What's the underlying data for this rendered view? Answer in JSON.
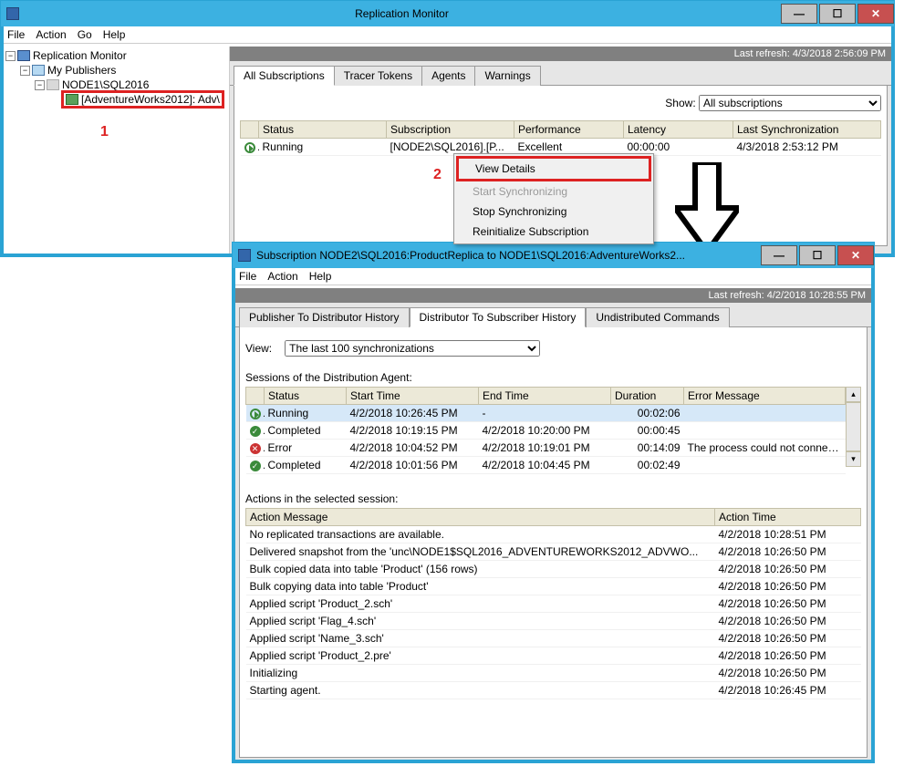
{
  "win1": {
    "title": "Replication Monitor",
    "menu": [
      "File",
      "Action",
      "Go",
      "Help"
    ],
    "refresh": "Last refresh: 4/3/2018 2:56:09 PM",
    "tree": {
      "root": "Replication Monitor",
      "pubs": "My Publishers",
      "node": "NODE1\\SQL2016",
      "db": "[AdventureWorks2012]: Adv\\"
    },
    "tabs": [
      "All Subscriptions",
      "Tracer Tokens",
      "Agents",
      "Warnings"
    ],
    "filter": {
      "label": "Show:",
      "selected": "All subscriptions"
    },
    "cols": {
      "status": "Status",
      "sub": "Subscription",
      "perf": "Performance",
      "lat": "Latency",
      "sync": "Last Synchronization"
    },
    "row": {
      "status": "Running",
      "sub": "[NODE2\\SQL2016].[P...",
      "perf": "Excellent",
      "lat": "00:00:00",
      "sync": "4/3/2018 2:53:12 PM"
    },
    "ctx": {
      "view": "View Details",
      "start": "Start Synchronizing",
      "stop": "Stop Synchronizing",
      "reinit": "Reinitialize Subscription"
    },
    "annot1": "1",
    "annot2": "2"
  },
  "win2": {
    "title": "Subscription NODE2\\SQL2016:ProductReplica to NODE1\\SQL2016:AdventureWorks2...",
    "menu": [
      "File",
      "Action",
      "Help"
    ],
    "refresh": "Last refresh: 4/2/2018 10:28:55 PM",
    "tabs": [
      "Publisher To Distributor History",
      "Distributor To Subscriber History",
      "Undistributed Commands"
    ],
    "view": {
      "label": "View:",
      "selected": "The last 100 synchronizations"
    },
    "sessions_label": "Sessions of the Distribution Agent:",
    "sess_cols": {
      "status": "Status",
      "start": "Start Time",
      "end": "End Time",
      "dur": "Duration",
      "err": "Error Message"
    },
    "sessions": [
      {
        "status": "Running",
        "icon": "running",
        "start": "4/2/2018 10:26:45 PM",
        "end": "-",
        "dur": "00:02:06",
        "err": ""
      },
      {
        "status": "Completed",
        "icon": "completed",
        "start": "4/2/2018 10:19:15 PM",
        "end": "4/2/2018 10:20:00 PM",
        "dur": "00:00:45",
        "err": ""
      },
      {
        "status": "Error",
        "icon": "error",
        "start": "4/2/2018 10:04:52 PM",
        "end": "4/2/2018 10:19:01 PM",
        "dur": "00:14:09",
        "err": "The process could not connect t..."
      },
      {
        "status": "Completed",
        "icon": "completed",
        "start": "4/2/2018 10:01:56 PM",
        "end": "4/2/2018 10:04:45 PM",
        "dur": "00:02:49",
        "err": ""
      }
    ],
    "actions_label": "Actions in the selected session:",
    "act_cols": {
      "msg": "Action Message",
      "time": "Action Time"
    },
    "actions": [
      {
        "msg": "No replicated transactions are available.",
        "time": "4/2/2018 10:28:51 PM"
      },
      {
        "msg": "Delivered snapshot from the 'unc\\NODE1$SQL2016_ADVENTUREWORKS2012_ADVWO...",
        "time": "4/2/2018 10:26:50 PM"
      },
      {
        "msg": "Bulk copied data into table 'Product' (156 rows)",
        "time": "4/2/2018 10:26:50 PM"
      },
      {
        "msg": "Bulk copying data into table 'Product'",
        "time": "4/2/2018 10:26:50 PM"
      },
      {
        "msg": "Applied script 'Product_2.sch'",
        "time": "4/2/2018 10:26:50 PM"
      },
      {
        "msg": "Applied script 'Flag_4.sch'",
        "time": "4/2/2018 10:26:50 PM"
      },
      {
        "msg": "Applied script 'Name_3.sch'",
        "time": "4/2/2018 10:26:50 PM"
      },
      {
        "msg": "Applied script 'Product_2.pre'",
        "time": "4/2/2018 10:26:50 PM"
      },
      {
        "msg": "Initializing",
        "time": "4/2/2018 10:26:50 PM"
      },
      {
        "msg": "Starting agent.",
        "time": "4/2/2018 10:26:45 PM"
      }
    ]
  }
}
